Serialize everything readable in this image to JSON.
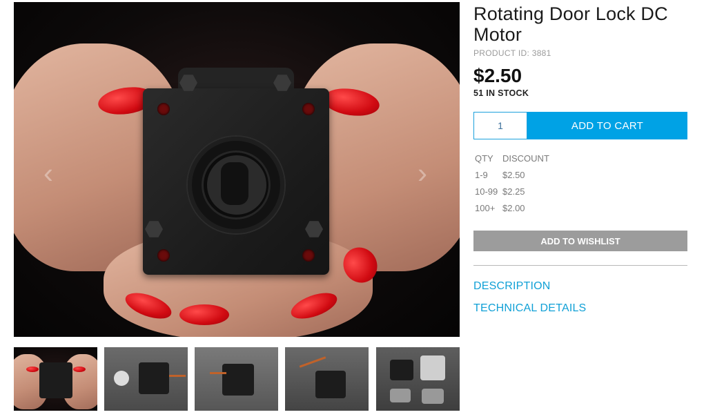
{
  "product": {
    "title": "Rotating Door Lock DC Motor",
    "product_id_label": "PRODUCT ID: 3881",
    "price": "$2.50",
    "stock": "51 IN STOCK"
  },
  "cart": {
    "quantity_value": "1",
    "add_to_cart_label": "ADD TO CART",
    "add_to_wishlist_label": "ADD TO WISHLIST"
  },
  "discount_table": {
    "headers": [
      "QTY",
      "DISCOUNT"
    ],
    "rows": [
      {
        "qty": "1-9",
        "price": "$2.50"
      },
      {
        "qty": "10-99",
        "price": "$2.25"
      },
      {
        "qty": "100+",
        "price": "$2.00"
      }
    ]
  },
  "tabs": {
    "description": "DESCRIPTION",
    "technical_details": "TECHNICAL DETAILS"
  },
  "gallery": {
    "prev_icon": "chevron-left-icon",
    "next_icon": "chevron-right-icon",
    "thumbnail_count": 5
  },
  "colors": {
    "accent": "#00a2e5",
    "link": "#10a0d6",
    "wishlist": "#9c9c9c"
  }
}
